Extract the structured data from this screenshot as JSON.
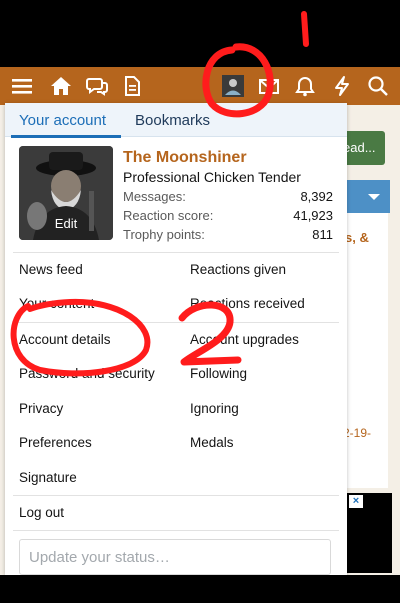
{
  "navbar": {
    "icons": [
      "menu-icon",
      "home-icon",
      "chat-icon",
      "document-icon",
      "avatar-icon",
      "envelope-icon",
      "bell-icon",
      "lightning-icon",
      "search-icon"
    ],
    "color": "#b5651d"
  },
  "background": {
    "button_text": "ead...",
    "orange_text": "s, &",
    "date_text": "2-19-",
    "ad_close": "×"
  },
  "menu": {
    "tabs": [
      "Your account",
      "Bookmarks"
    ],
    "user": {
      "name": "The Moonshiner",
      "title": "Professional Chicken Tender",
      "avatar_edit": "Edit",
      "stats": [
        {
          "label": "Messages:",
          "value": "8,392"
        },
        {
          "label": "Reaction score:",
          "value": "41,923"
        },
        {
          "label": "Trophy points:",
          "value": "811"
        }
      ]
    },
    "left_links": [
      "News feed",
      "Your content",
      "Account details",
      "Password and security",
      "Privacy",
      "Preferences",
      "Signature"
    ],
    "right_links": [
      "Reactions given",
      "Reactions received",
      "Account upgrades",
      "Following",
      "Ignoring",
      "Medals"
    ],
    "logout": "Log out",
    "status_placeholder": "Update your status…"
  },
  "annotations": {
    "one": "1",
    "two": "2",
    "color": "#ff1c1c"
  }
}
